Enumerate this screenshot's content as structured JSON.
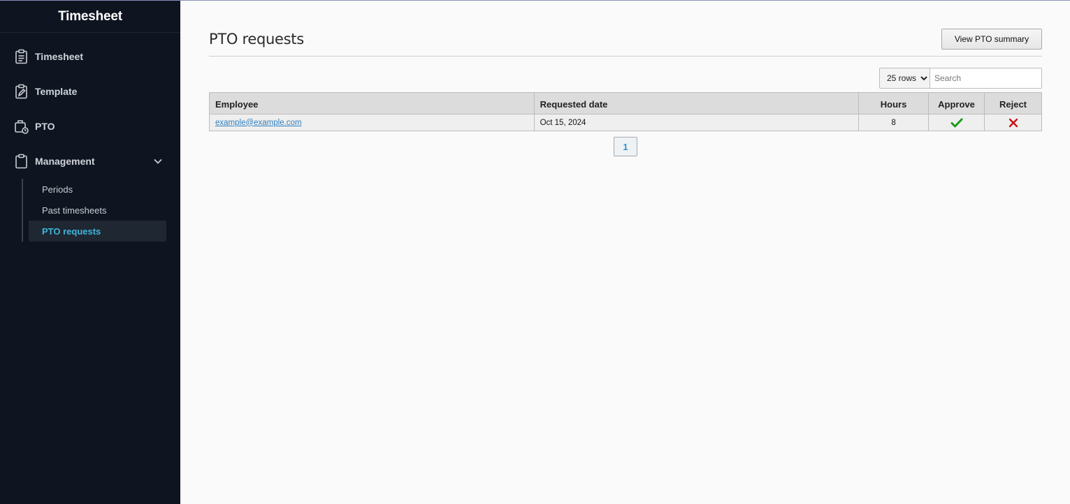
{
  "sidebar": {
    "brand": "Timesheet",
    "items": [
      {
        "label": "Timesheet",
        "icon": "clipboard-list-icon"
      },
      {
        "label": "Template",
        "icon": "clipboard-edit-icon"
      },
      {
        "label": "PTO",
        "icon": "briefcase-clock-icon"
      },
      {
        "label": "Management",
        "icon": "clipboard-icon"
      }
    ],
    "management_expanded": true,
    "sub_items": [
      {
        "label": "Periods"
      },
      {
        "label": "Past timesheets"
      },
      {
        "label": "PTO requests",
        "active": true
      }
    ]
  },
  "main": {
    "title": "PTO requests",
    "summary_button": "View PTO summary",
    "rows_select": {
      "selected": "25 rows",
      "options": [
        "25 rows"
      ]
    },
    "search": {
      "placeholder": "Search",
      "value": ""
    },
    "table": {
      "columns": [
        "Employee",
        "Requested date",
        "Hours",
        "Approve",
        "Reject"
      ],
      "rows": [
        {
          "employee": "example@example.com",
          "requested_date": "Oct 15, 2024",
          "hours": "8"
        }
      ]
    },
    "pagination": {
      "current": "1"
    }
  },
  "colors": {
    "sidebar_bg": "#0e1521",
    "active_accent": "#3fb5d9",
    "link": "#2f7fc0",
    "approve": "#1a9a1a",
    "reject": "#cc1111"
  }
}
